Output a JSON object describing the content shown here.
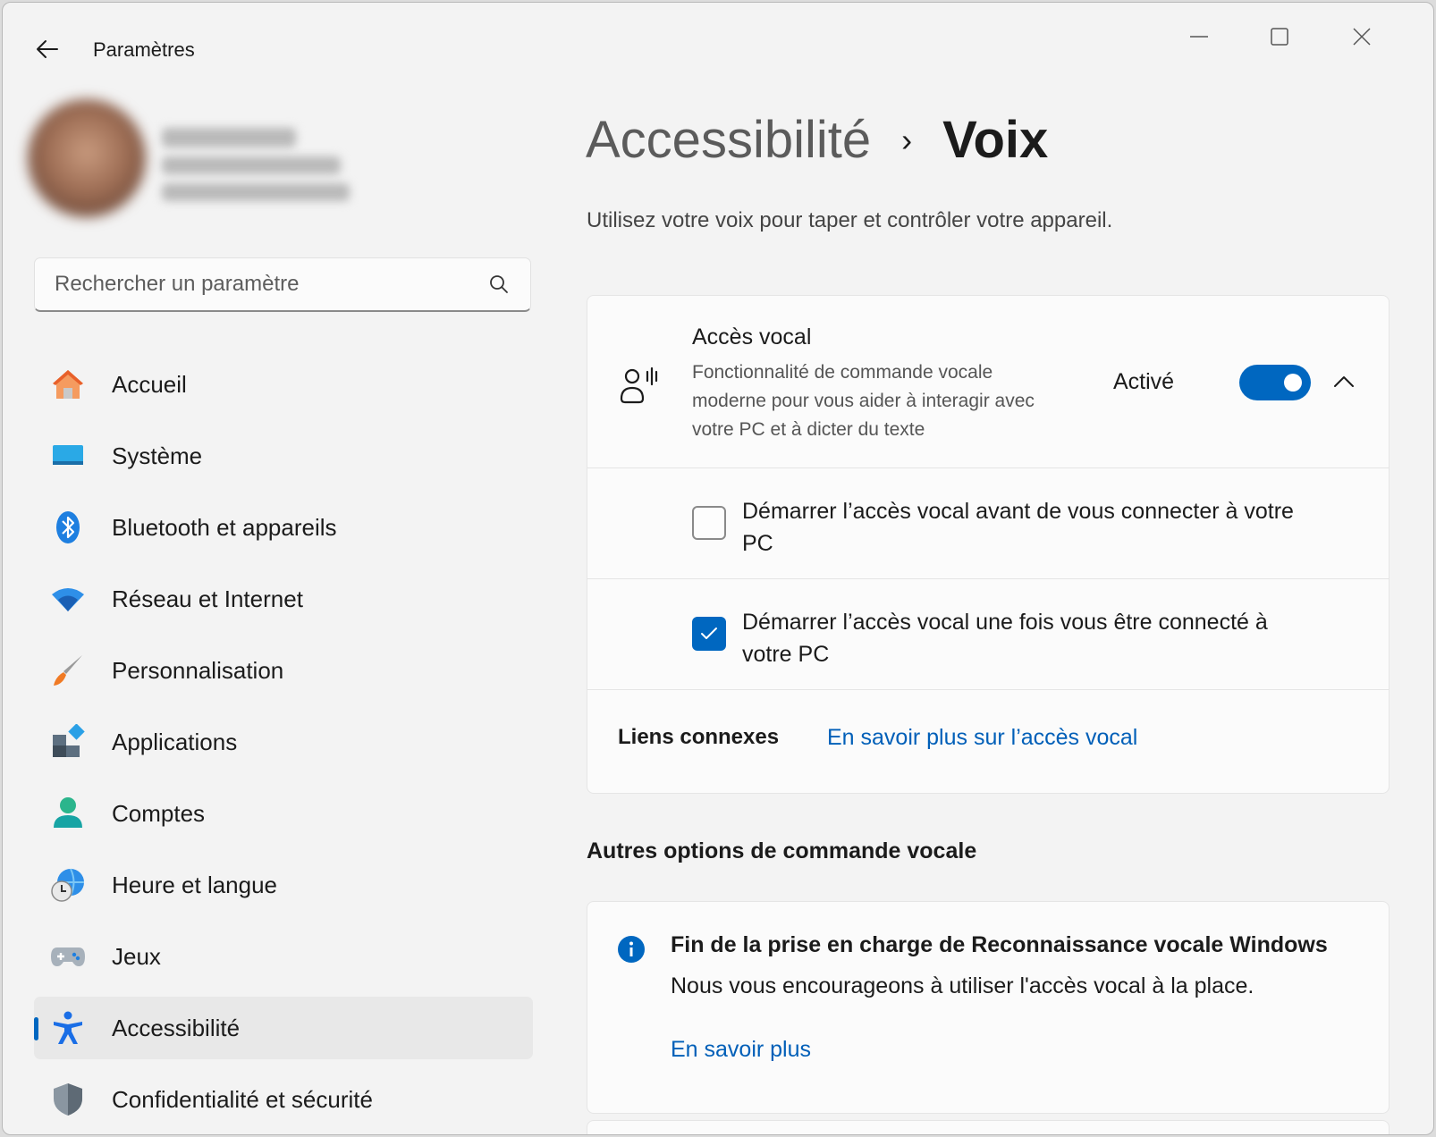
{
  "window": {
    "title": "Paramètres"
  },
  "search": {
    "placeholder": "Rechercher un paramètre"
  },
  "sidebar": {
    "items": [
      {
        "label": "Accueil",
        "icon": "home-icon"
      },
      {
        "label": "Système",
        "icon": "system-icon"
      },
      {
        "label": "Bluetooth et appareils",
        "icon": "bluetooth-icon"
      },
      {
        "label": "Réseau et Internet",
        "icon": "wifi-icon"
      },
      {
        "label": "Personnalisation",
        "icon": "paintbrush-icon"
      },
      {
        "label": "Applications",
        "icon": "apps-icon"
      },
      {
        "label": "Comptes",
        "icon": "person-icon"
      },
      {
        "label": "Heure et langue",
        "icon": "globe-clock-icon"
      },
      {
        "label": "Jeux",
        "icon": "gamepad-icon"
      },
      {
        "label": "Accessibilité",
        "icon": "accessibility-icon",
        "active": true
      },
      {
        "label": "Confidentialité et sécurité",
        "icon": "shield-icon"
      }
    ]
  },
  "breadcrumb": {
    "parent": "Accessibilité",
    "separator": "›",
    "current": "Voix"
  },
  "page": {
    "subtitle": "Utilisez votre voix pour taper et contrôler votre appareil."
  },
  "voice_access": {
    "title": "Accès vocal",
    "description": "Fonctionnalité de commande vocale moderne pour vous aider à interagir avec votre PC et à dicter du texte",
    "state_label": "Activé",
    "enabled": true,
    "options": [
      {
        "label": "Démarrer l’accès vocal avant de vous connecter à votre PC",
        "checked": false
      },
      {
        "label": "Démarrer l’accès vocal une fois vous être connecté à votre PC",
        "checked": true
      }
    ],
    "related_links_label": "Liens connexes",
    "related_link": "En savoir plus sur l’accès vocal"
  },
  "other_options": {
    "section_title": "Autres options de commande vocale",
    "notice_title": "Fin de la prise en charge de Reconnaissance vocale Windows",
    "notice_text": "Nous vous encourageons à utiliser l'accès vocal à la place.",
    "notice_link": "En savoir plus"
  },
  "colors": {
    "accent": "#0067c0",
    "link": "#005fb8",
    "background": "#f3f3f3",
    "card": "#fbfbfb"
  }
}
